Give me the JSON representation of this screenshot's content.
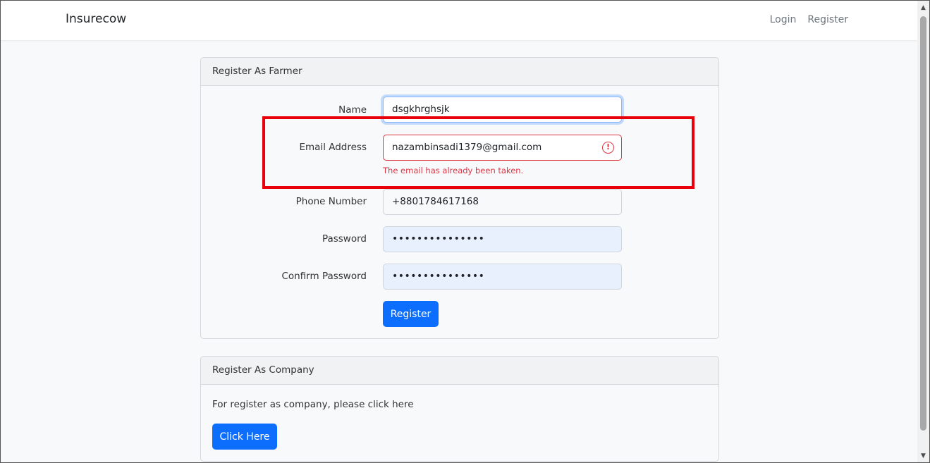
{
  "navbar": {
    "brand": "Insurecow",
    "login": "Login",
    "register": "Register"
  },
  "farmer_card": {
    "title": "Register As Farmer",
    "name_label": "Name",
    "name_value": "dsgkhrghsjk",
    "email_label": "Email Address",
    "email_value": "nazambinsadi1379@gmail.com",
    "email_error": "The email has already been taken.",
    "email_error_icon": "exclamation-circle-icon",
    "phone_label": "Phone Number",
    "phone_value": "+8801784617168",
    "password_label": "Password",
    "password_value": "•••••••••••••••",
    "confirm_label": "Confirm Password",
    "confirm_value": "•••••••••••••••",
    "submit_label": "Register"
  },
  "company_card": {
    "title": "Register As Company",
    "text": "For register as company, please click here",
    "button_label": "Click Here"
  },
  "colors": {
    "primary": "#0d6efd",
    "error": "#dc3545",
    "annotation": "#e8000b"
  }
}
